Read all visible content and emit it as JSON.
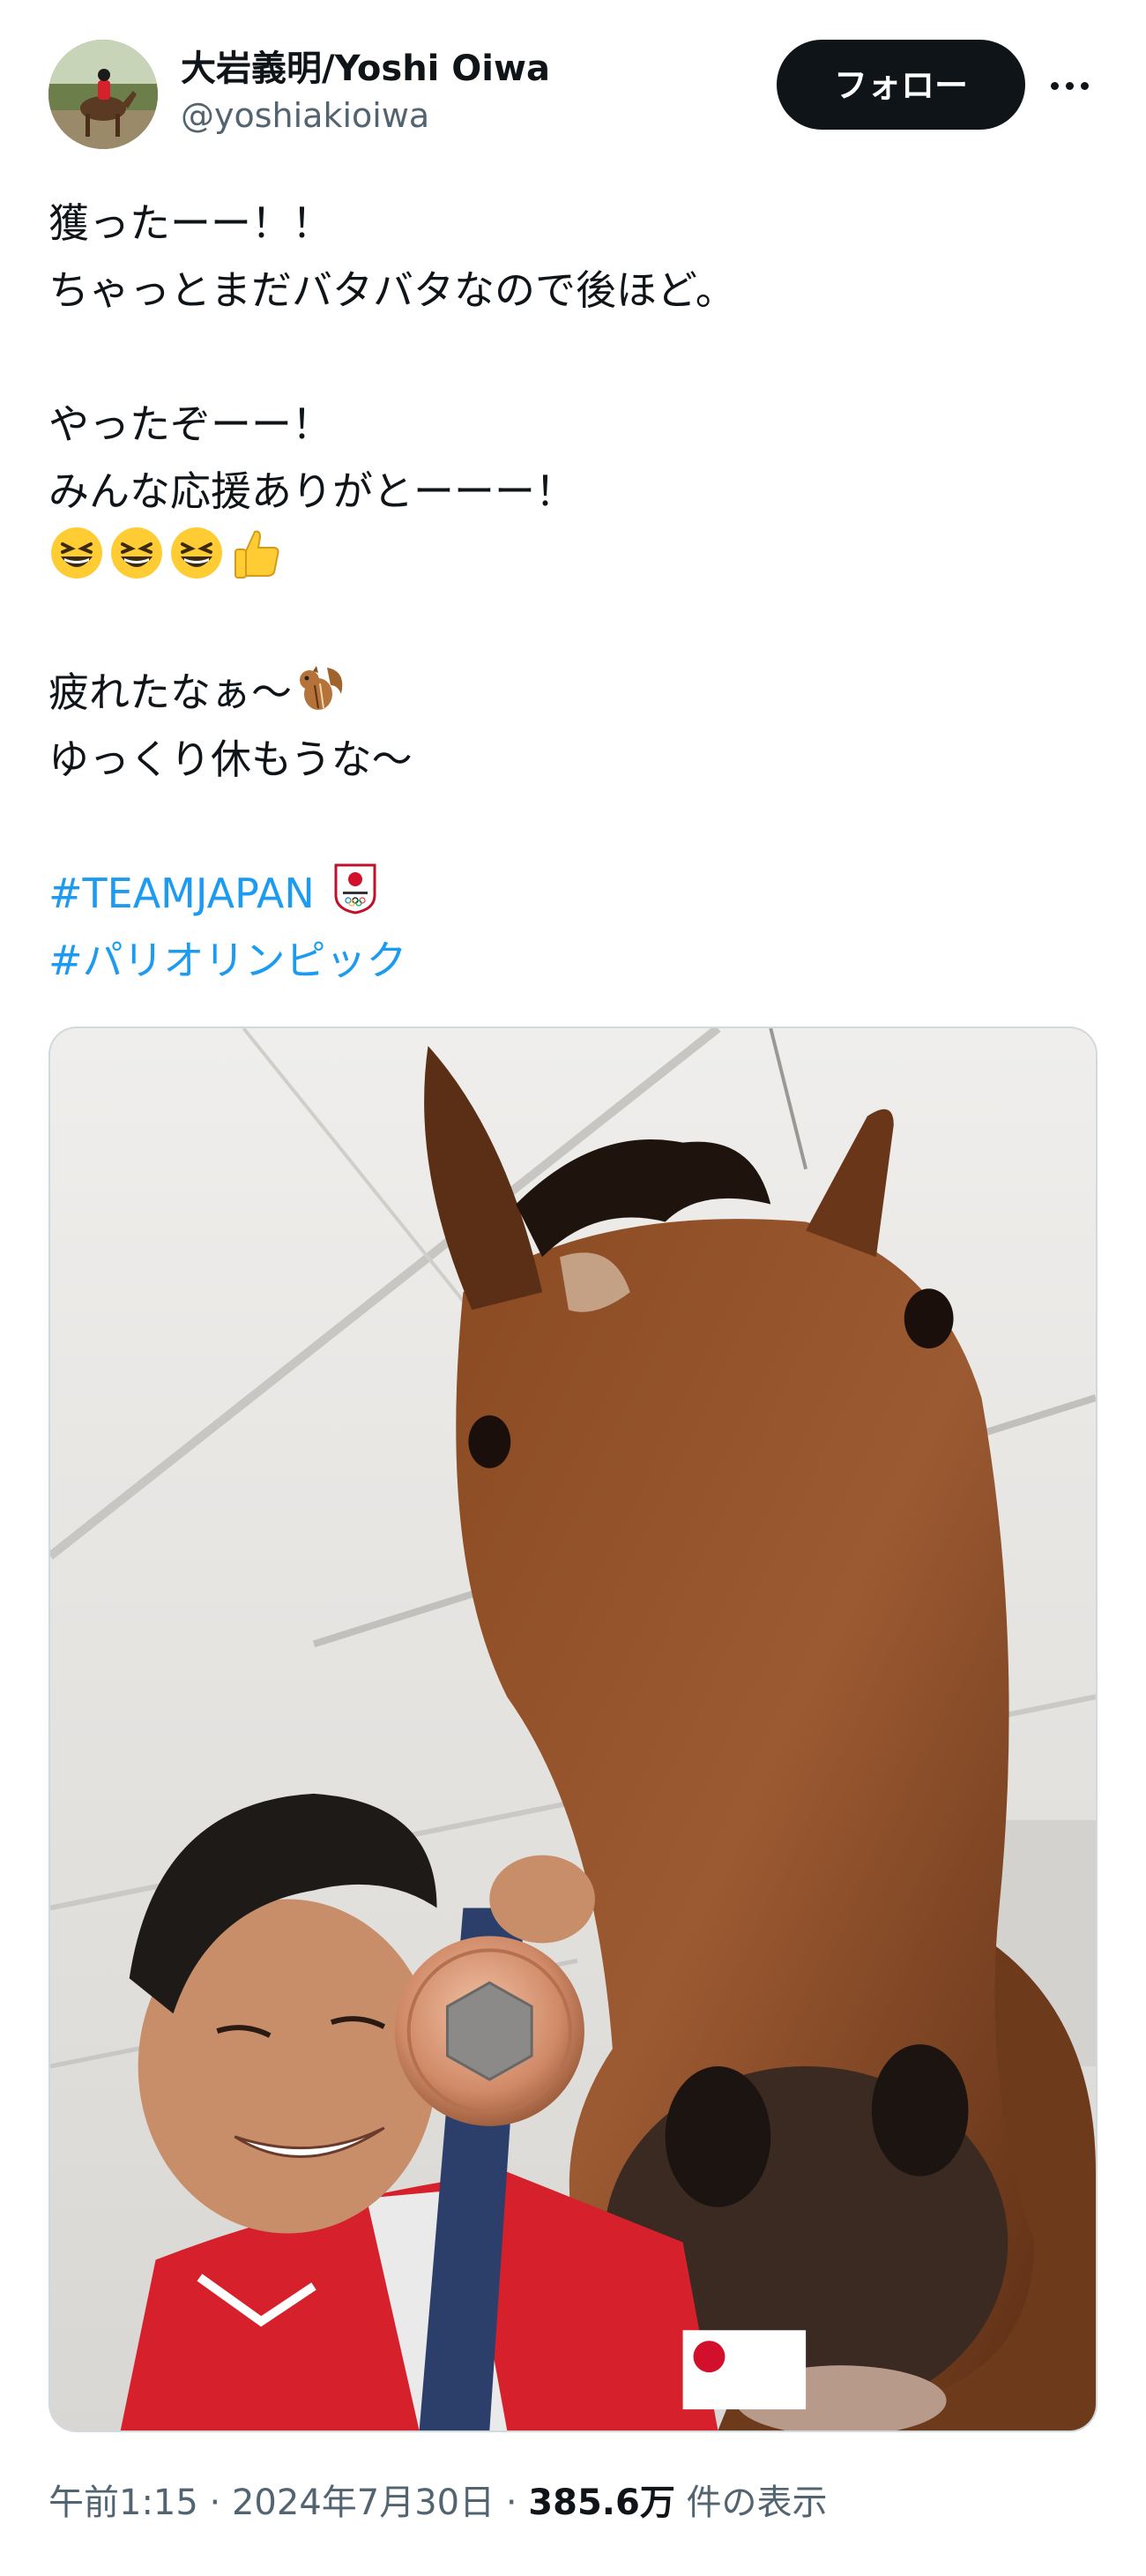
{
  "author": {
    "display_name": "大岩義明/Yoshi Oiwa",
    "handle": "@yoshiakioiwa",
    "avatar_icon": "avatar-horse-jumping"
  },
  "header": {
    "follow_label": "フォロー",
    "more_icon": "more-options-icon"
  },
  "tweet": {
    "lines": [
      "獲ったーー！！",
      "ちゃっとまだバタバタなので後ほど。",
      "",
      "やったぞーー！",
      "みんな応援ありがとーーー！",
      "",
      "",
      "疲れたなぁ〜",
      "ゆっくり休もうな〜",
      ""
    ],
    "emoji_row": [
      "grinning-squinting-face-icon",
      "grinning-squinting-face-icon",
      "grinning-squinting-face-icon",
      "thumbs-up-icon"
    ],
    "squirrel_emoji": "chipmunk-icon",
    "hashtags": [
      "#TEAMJAPAN",
      "#パリオリンピック"
    ],
    "team_japan_emoji": "team-japan-emblem-icon"
  },
  "media": {
    "description_icon": "photo-horse-rider-medal"
  },
  "meta": {
    "time": "午前1:15",
    "separator": " · ",
    "date": "2024年7月30日",
    "views_count": "385.6万",
    "views_label": " 件の表示"
  },
  "colors": {
    "text": "#0f1419",
    "secondary": "#536471",
    "link": "#1d9bf0",
    "button_bg": "#0f1419"
  }
}
